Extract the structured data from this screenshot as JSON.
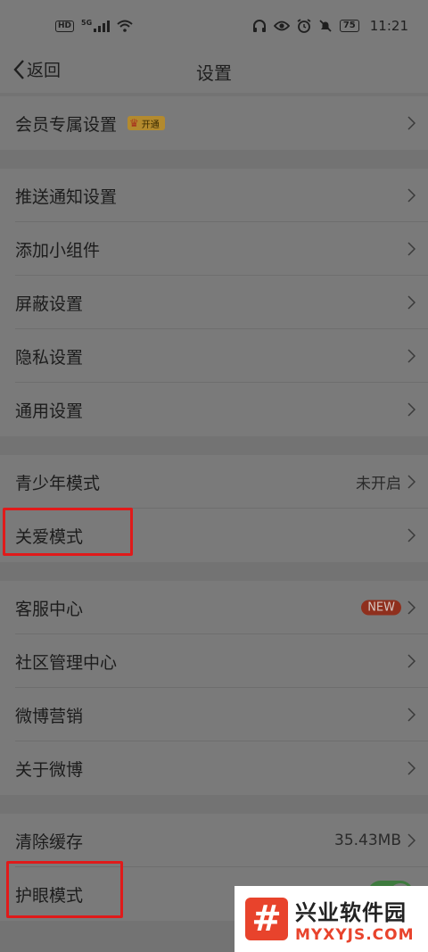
{
  "status_bar": {
    "hd": "HD",
    "network": "5G",
    "battery": "75",
    "time": "11:21"
  },
  "nav": {
    "back_label": "返回",
    "title": "设置"
  },
  "vip_row": {
    "label": "会员专属设置",
    "badge": "开通"
  },
  "group1": [
    {
      "label": "推送通知设置"
    },
    {
      "label": "添加小组件"
    },
    {
      "label": "屏蔽设置"
    },
    {
      "label": "隐私设置"
    },
    {
      "label": "通用设置"
    }
  ],
  "group2": [
    {
      "label": "青少年模式",
      "value": "未开启"
    },
    {
      "label": "关爱模式"
    }
  ],
  "group3": [
    {
      "label": "客服中心",
      "badge": "NEW"
    },
    {
      "label": "社区管理中心"
    },
    {
      "label": "微博营销"
    },
    {
      "label": "关于微博"
    }
  ],
  "group4": [
    {
      "label": "清除缓存",
      "value": "35.43MB"
    },
    {
      "label": "护眼模式",
      "toggle_on": true
    }
  ],
  "watermark": {
    "logo": "#",
    "title": "兴业软件园",
    "url": "MYXYJS.COM"
  },
  "colors": {
    "overlay_bg": "#737373",
    "row_bg": "#7a7a7a",
    "highlight": "#e01a1a",
    "toggle_on": "#3e7a3e",
    "brand_red": "#e8432c"
  }
}
